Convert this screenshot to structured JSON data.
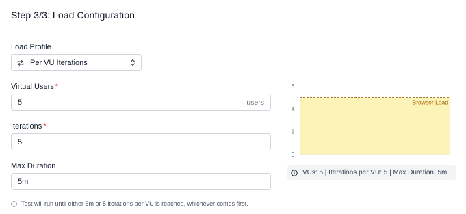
{
  "header": {
    "title": "Step 3/3: Load Configuration"
  },
  "load_profile": {
    "label": "Load Profile",
    "selected": "Per VU Iterations",
    "icon": "repeat-icon"
  },
  "virtual_users": {
    "label": "Virtual Users",
    "required_mark": "*",
    "value": "5",
    "suffix": "users"
  },
  "iterations": {
    "label": "Iterations",
    "required_mark": "*",
    "value": "5"
  },
  "max_duration": {
    "label": "Max Duration",
    "value": "5m"
  },
  "note": {
    "text": "Test will run until either 5m or 5 iterations per VU is reached, whichever comes first."
  },
  "summary": {
    "text": "VUs: 5 | Iterations per VU: 5 | Max Duration: 5m"
  },
  "chart_data": {
    "type": "area",
    "x": [
      0,
      1
    ],
    "series": [
      {
        "name": "Browser Load",
        "values": [
          5,
          5
        ]
      }
    ],
    "y_ticks": [
      "0",
      "2",
      "4",
      "6"
    ],
    "ylim": [
      0,
      6
    ],
    "grid": false,
    "fill_color": "#fcf3b8",
    "line_color": "#a16207"
  },
  "colors": {
    "required": "#dc2626",
    "border": "#d1d5db"
  }
}
